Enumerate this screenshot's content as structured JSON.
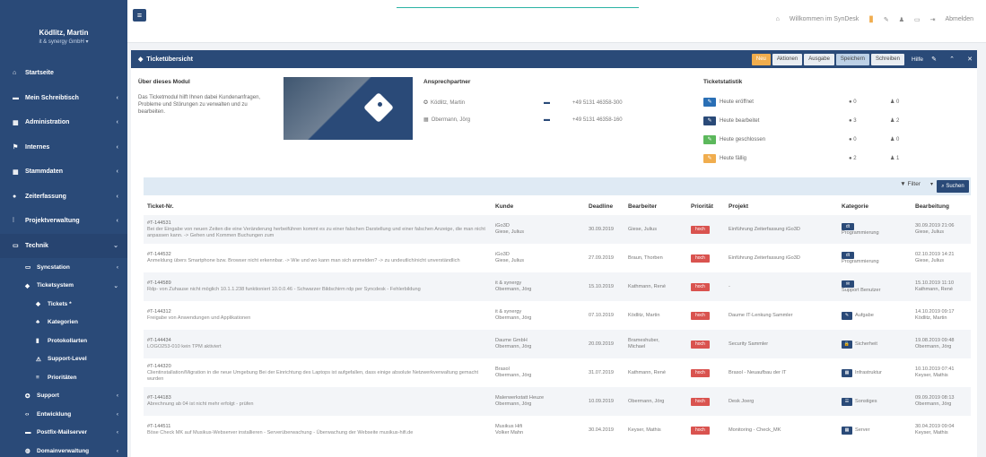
{
  "user": {
    "name": "Ködlitz, Martin",
    "company": "it & synergy GmbH ▾"
  },
  "sidebar": {
    "items": [
      {
        "label": "Startseite",
        "icon": "home-icon",
        "glyph": "⌂",
        "chev": ""
      },
      {
        "label": "Mein Schreibtisch",
        "icon": "desk-icon",
        "glyph": "▬",
        "chev": "‹"
      },
      {
        "label": "Administration",
        "icon": "grid-icon",
        "glyph": "▦",
        "chev": "‹"
      },
      {
        "label": "Internes",
        "icon": "users-icon",
        "glyph": "⚑",
        "chev": "‹"
      },
      {
        "label": "Stammdaten",
        "icon": "table-icon",
        "glyph": "▦",
        "chev": "‹"
      },
      {
        "label": "Zeiterfassung",
        "icon": "clock-icon",
        "glyph": "●",
        "chev": "‹"
      },
      {
        "label": "Projektverwaltung",
        "icon": "chart-icon",
        "glyph": "⫶",
        "chev": "‹"
      },
      {
        "label": "Technik",
        "icon": "monitor-icon",
        "glyph": "▭",
        "chev": "⌄"
      }
    ],
    "technik_sub": [
      {
        "label": "Syncstation",
        "icon": "monitor-icon",
        "glyph": "▭",
        "chev": "‹",
        "level": 1
      },
      {
        "label": "Ticketsystem",
        "icon": "ticket-icon",
        "glyph": "◆",
        "chev": "⌄",
        "level": 1
      },
      {
        "label": "Tickets *",
        "icon": "tag-icon",
        "glyph": "◆",
        "chev": "",
        "level": 2
      },
      {
        "label": "Kategorien",
        "icon": "cubes-icon",
        "glyph": "♣",
        "chev": "",
        "level": 2
      },
      {
        "label": "Protokollarten",
        "icon": "doc-icon",
        "glyph": "▮",
        "chev": "",
        "level": 2
      },
      {
        "label": "Support-Level",
        "icon": "level-icon",
        "glyph": "⚠",
        "chev": "",
        "level": 2
      },
      {
        "label": "Prioritäten",
        "icon": "priority-icon",
        "glyph": "≡",
        "chev": "",
        "level": 2
      }
    ],
    "bottom": [
      {
        "label": "Support",
        "icon": "support-icon",
        "glyph": "✪",
        "chev": "‹"
      },
      {
        "label": "Entwicklung",
        "icon": "code-icon",
        "glyph": "‹›",
        "chev": "‹"
      },
      {
        "label": "Postfix-Mailserver",
        "icon": "mail-icon",
        "glyph": "▬",
        "chev": "‹"
      },
      {
        "label": "Domainverwaltung",
        "icon": "globe-icon",
        "glyph": "◍",
        "chev": "‹"
      },
      {
        "label": "Lizenzverwaltung",
        "icon": "license-icon",
        "glyph": "♜",
        "chev": "‹"
      }
    ]
  },
  "topbar": {
    "welcome": "Willkommen im SynDesk",
    "logout": "Abmelden"
  },
  "panel": {
    "title": "Ticketübersicht",
    "buttons": {
      "neu": "Neu",
      "aktionen": "Aktionen",
      "ausgabe": "Ausgabe",
      "speichern": "Speichern",
      "schreiben": "Schreiben",
      "hilfe": "Hilfe"
    }
  },
  "about": {
    "heading": "Über dieses Modul",
    "text": "Das Ticketmodul hilft Ihnen dabei Kundenanfragen, Probleme und Störungen zu verwalten und zu bearbeiten."
  },
  "contacts": {
    "heading": "Ansprechpartner",
    "rows": [
      {
        "name": "Ködlitz, Martin",
        "phone": "+49 5131 46358-300",
        "icon": "gear-icon",
        "glyph": "✪"
      },
      {
        "name": "Obermann, Jörg",
        "phone": "+49 5131 46358-160",
        "icon": "building-icon",
        "glyph": "▦"
      }
    ]
  },
  "stats": {
    "heading": "Ticketstatistik",
    "rows": [
      {
        "label": "Heute eröffnet",
        "color": "#2a6fb5",
        "v1": "0",
        "v2": "0"
      },
      {
        "label": "Heute bearbeitet",
        "color": "#2a4a78",
        "v1": "3",
        "v2": "2"
      },
      {
        "label": "Heute geschlossen",
        "color": "#5cb85c",
        "v1": "0",
        "v2": "0"
      },
      {
        "label": "Heute fällig",
        "color": "#f0ad4e",
        "v1": "2",
        "v2": "1"
      }
    ]
  },
  "filter": {
    "filter_label": "Filter",
    "search_label": "Suchen"
  },
  "table": {
    "headers": [
      "Ticket-Nr.",
      "Kunde",
      "Deadline",
      "Bearbeiter",
      "Priorität",
      "Projekt",
      "Kategorie",
      "Bearbeitung"
    ],
    "rows": [
      {
        "nr": "#T-144531",
        "desc": "Bei der Eingabe von neuen Zeiten die eine Veränderung herbeiführen kommt es zu einer falschen Darstellung und einer falschen Anzeige, die man nicht anpassen kann. -> Gehen und Kommen Buchungen zum",
        "kunde1": "iGo3D",
        "kunde2": "Giese, Julius",
        "deadline": "30.09.2019",
        "bearb1": "Giese, Julius",
        "bearb2": "",
        "prio": "hoch",
        "projekt": "Einführung Zeiterfassung iGo3D",
        "kat_badge": "dt",
        "kat": "Programmierung",
        "kat_stack": true,
        "edit1": "30.09.2019 21:06",
        "edit2": "Giese, Julius"
      },
      {
        "nr": "#T-144532",
        "desc": "Anmeldung übers Smartphone bzw. Browser nicht erkennbar. -> Wie und wo kann man sich anmelden? -> zu undeutlich/nicht unverständlich",
        "kunde1": "iGo3D",
        "kunde2": "Giese, Julius",
        "deadline": "27.09.2019",
        "bearb1": "Braun, Thorben",
        "bearb2": "",
        "prio": "hoch",
        "projekt": "Einführung Zeiterfassung iGo3D",
        "kat_badge": "dt",
        "kat": "Programmierung",
        "kat_stack": true,
        "edit1": "02.10.2019 14:21",
        "edit2": "Giese, Julius"
      },
      {
        "nr": "#T-144589",
        "desc": "Rdp- von Zuhause nicht möglich 10.1.1.238 funktioniert 10.0.0.46 - Schwarzer Bildschirm rdp per Syncdesk - Fehlerbildung",
        "kunde1": "it & synergy",
        "kunde2": "Obermann, Jörg",
        "deadline": "15.10.2019",
        "bearb1": "Kathmann, René",
        "bearb2": "",
        "prio": "hoch",
        "projekt": "-",
        "kat_badge": "✉",
        "kat": "Support Benutzer",
        "kat_stack": true,
        "edit1": "15.10.2019 11:10",
        "edit2": "Kathmann, René"
      },
      {
        "nr": "#T-144312",
        "desc": "Freigabe von Anwendungen und Applikationen",
        "kunde1": "it & synergy",
        "kunde2": "Obermann, Jörg",
        "deadline": "07.10.2019",
        "bearb1": "Ködlitz, Martin",
        "bearb2": "",
        "prio": "hoch",
        "projekt": "Daume IT-Lenkung Sammler",
        "kat_badge": "✎",
        "kat": "Aufgabe",
        "kat_stack": false,
        "edit1": "14.10.2019 09:17",
        "edit2": "Ködlitz, Martin"
      },
      {
        "nr": "#T-144434",
        "desc": "LOGO253-010 kein TPM aktiviert",
        "kunde1": "Daume GmbH",
        "kunde2": "Obermann, Jörg",
        "deadline": "20.09.2019",
        "bearb1": "Brameshuber,",
        "bearb2": "Michael",
        "prio": "hoch",
        "projekt": "Security Sammler",
        "kat_badge": "🔒",
        "kat": "Sicherheit",
        "kat_stack": false,
        "edit1": "19.08.2019 09:48",
        "edit2": "Obermann, Jörg"
      },
      {
        "nr": "#T-144320",
        "desc": "Clientinstallation/Migration in die neue Umgebung Bei der Einrichtung des Laptops ist aufgefallen, dass einige absolute Netzwerkverwaltung gemacht wurden",
        "kunde1": "Brasol",
        "kunde2": "Obermann, Jörg",
        "deadline": "31.07.2019",
        "bearb1": "Kathmann, René",
        "bearb2": "",
        "prio": "hoch",
        "projekt": "Brasol - Neuaufbau der IT",
        "kat_badge": "▦",
        "kat": "Infrastruktur",
        "kat_stack": false,
        "edit1": "10.10.2019 07:41",
        "edit2": "Keyser, Mathis"
      },
      {
        "nr": "#T-144183",
        "desc": "Abrechnung ab 04 ist nicht mehr erfolgt - prüfen",
        "kunde1": "Malerwerkstatt Heuze",
        "kunde2": "Obermann, Jörg",
        "deadline": "10.09.2019",
        "bearb1": "Obermann, Jörg",
        "bearb2": "",
        "prio": "hoch",
        "projekt": "Desk Joerg",
        "kat_badge": "☰",
        "kat": "Sonstiges",
        "kat_stack": false,
        "edit1": "09.09.2019 08:13",
        "edit2": "Obermann, Jörg"
      },
      {
        "nr": "#T-144511",
        "desc": "Böse Check MK auf Musikus-Webserver installieren - Serverüberwachung - Überwachung der Webseite musikus-hifi.de",
        "kunde1": "Musikus Hifi",
        "kunde2": "Volker Mahn",
        "deadline": "30.04.2019",
        "bearb1": "Keyser, Mathis",
        "bearb2": "",
        "prio": "hoch",
        "projekt": "Monitoring - Check_MK",
        "kat_badge": "▦",
        "kat": "Server",
        "kat_stack": false,
        "edit1": "30.04.2019 09:04",
        "edit2": "Keyser, Mathis"
      }
    ]
  }
}
